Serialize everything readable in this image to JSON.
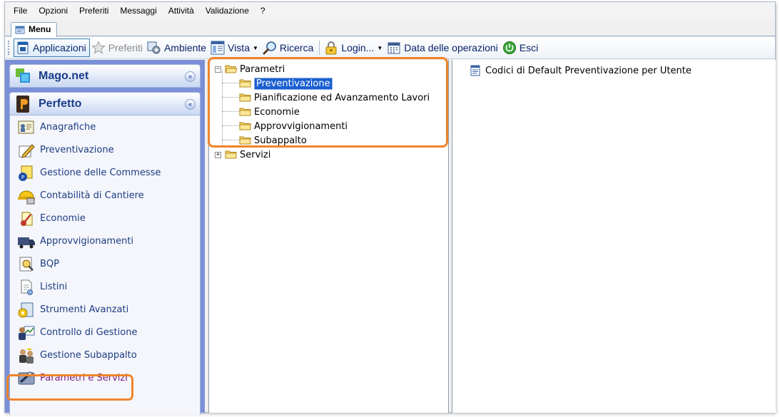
{
  "menubar": {
    "items": [
      "File",
      "Opzioni",
      "Preferiti",
      "Messaggi",
      "Attività",
      "Validazione",
      "?"
    ]
  },
  "tab": {
    "label": "Menu"
  },
  "toolbar": {
    "applicazioni": "Applicazioni",
    "preferiti": "Preferiti",
    "ambiente": "Ambiente",
    "vista": "Vista",
    "ricerca": "Ricerca",
    "login": "Login...",
    "data_operazioni": "Data delle operazioni",
    "esci": "Esci"
  },
  "groups": {
    "mago": "Mago.net",
    "perfetto": "Perfetto"
  },
  "sidebar": {
    "items": [
      "Anagrafiche",
      "Preventivazione",
      "Gestione delle Commesse",
      "Contabilità di Cantiere",
      "Economie",
      "Approvvigionamenti",
      "BQP",
      "Listini",
      "Strumenti Avanzati",
      "Controllo di Gestione",
      "Gestione Subappalto",
      "Parametri e Servizi"
    ],
    "selected_index": 11
  },
  "tree": {
    "parametri": "Parametri",
    "children": [
      "Preventivazione",
      "Pianificazione ed Avanzamento Lavori",
      "Economie",
      "Approvvigionamenti",
      "Subappalto"
    ],
    "selected_index": 0,
    "servizi": "Servizi"
  },
  "detail": {
    "items": [
      "Codici di Default Preventivazione per Utente"
    ]
  },
  "colors": {
    "highlight": "#f0842a",
    "sidebar_bg": "#7b8fd8",
    "selection": "#1a5fd0"
  }
}
